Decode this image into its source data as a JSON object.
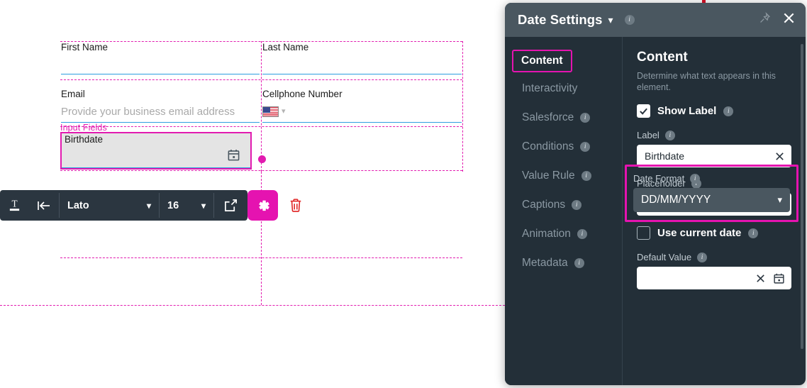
{
  "canvas": {
    "fields": [
      {
        "label": "First Name",
        "placeholder": ""
      },
      {
        "label": "Last Name",
        "placeholder": ""
      },
      {
        "label": "Email",
        "placeholder": "Provide your business email address"
      },
      {
        "label": "Cellphone Number",
        "placeholder": ""
      }
    ],
    "section_tag": "Input Fields",
    "selected_field": {
      "label": "Birthdate"
    }
  },
  "toolbar": {
    "text_style_icon": "text-format-icon",
    "align_icon": "indent-left-icon",
    "font_family": "Lato",
    "font_size": "16",
    "open_icon": "external-link-icon",
    "settings_icon": "gear-icon",
    "delete_icon": "trash-icon"
  },
  "panel": {
    "title": "Date Settings",
    "title_chevron": "chevron-down-icon",
    "info_icon": "info-icon",
    "pin_icon": "pin-icon",
    "close_icon": "close-icon",
    "accent_color": "#e513b0",
    "header_bg": "#4a5760",
    "body_bg": "#232f38"
  },
  "tabs": [
    {
      "label": "Content",
      "active": true,
      "info": false
    },
    {
      "label": "Interactivity",
      "active": false,
      "info": false
    },
    {
      "label": "Salesforce",
      "active": false,
      "info": true
    },
    {
      "label": "Conditions",
      "active": false,
      "info": true
    },
    {
      "label": "Value Rule",
      "active": false,
      "info": true
    },
    {
      "label": "Captions",
      "active": false,
      "info": true
    },
    {
      "label": "Animation",
      "active": false,
      "info": true
    },
    {
      "label": "Metadata",
      "active": false,
      "info": true
    }
  ],
  "content": {
    "heading": "Content",
    "description": "Determine what text appears in this element.",
    "show_label": {
      "text": "Show Label",
      "checked": true
    },
    "label_field": {
      "label": "Label",
      "value": "Birthdate",
      "clear_icon": "close-icon"
    },
    "placeholder_field": {
      "label": "Placeholder",
      "value": "",
      "clear_icon": "close-icon"
    },
    "use_current_date": {
      "text": "Use current date",
      "checked": false
    },
    "default_value_field": {
      "label": "Default Value",
      "value": "",
      "clear_icon": "close-icon",
      "calendar_icon": "calendar-icon"
    },
    "date_format": {
      "label": "Date Format",
      "value": "DD/MM/YYYY",
      "chevron": "chevron-down-icon",
      "highlighted": true
    }
  }
}
